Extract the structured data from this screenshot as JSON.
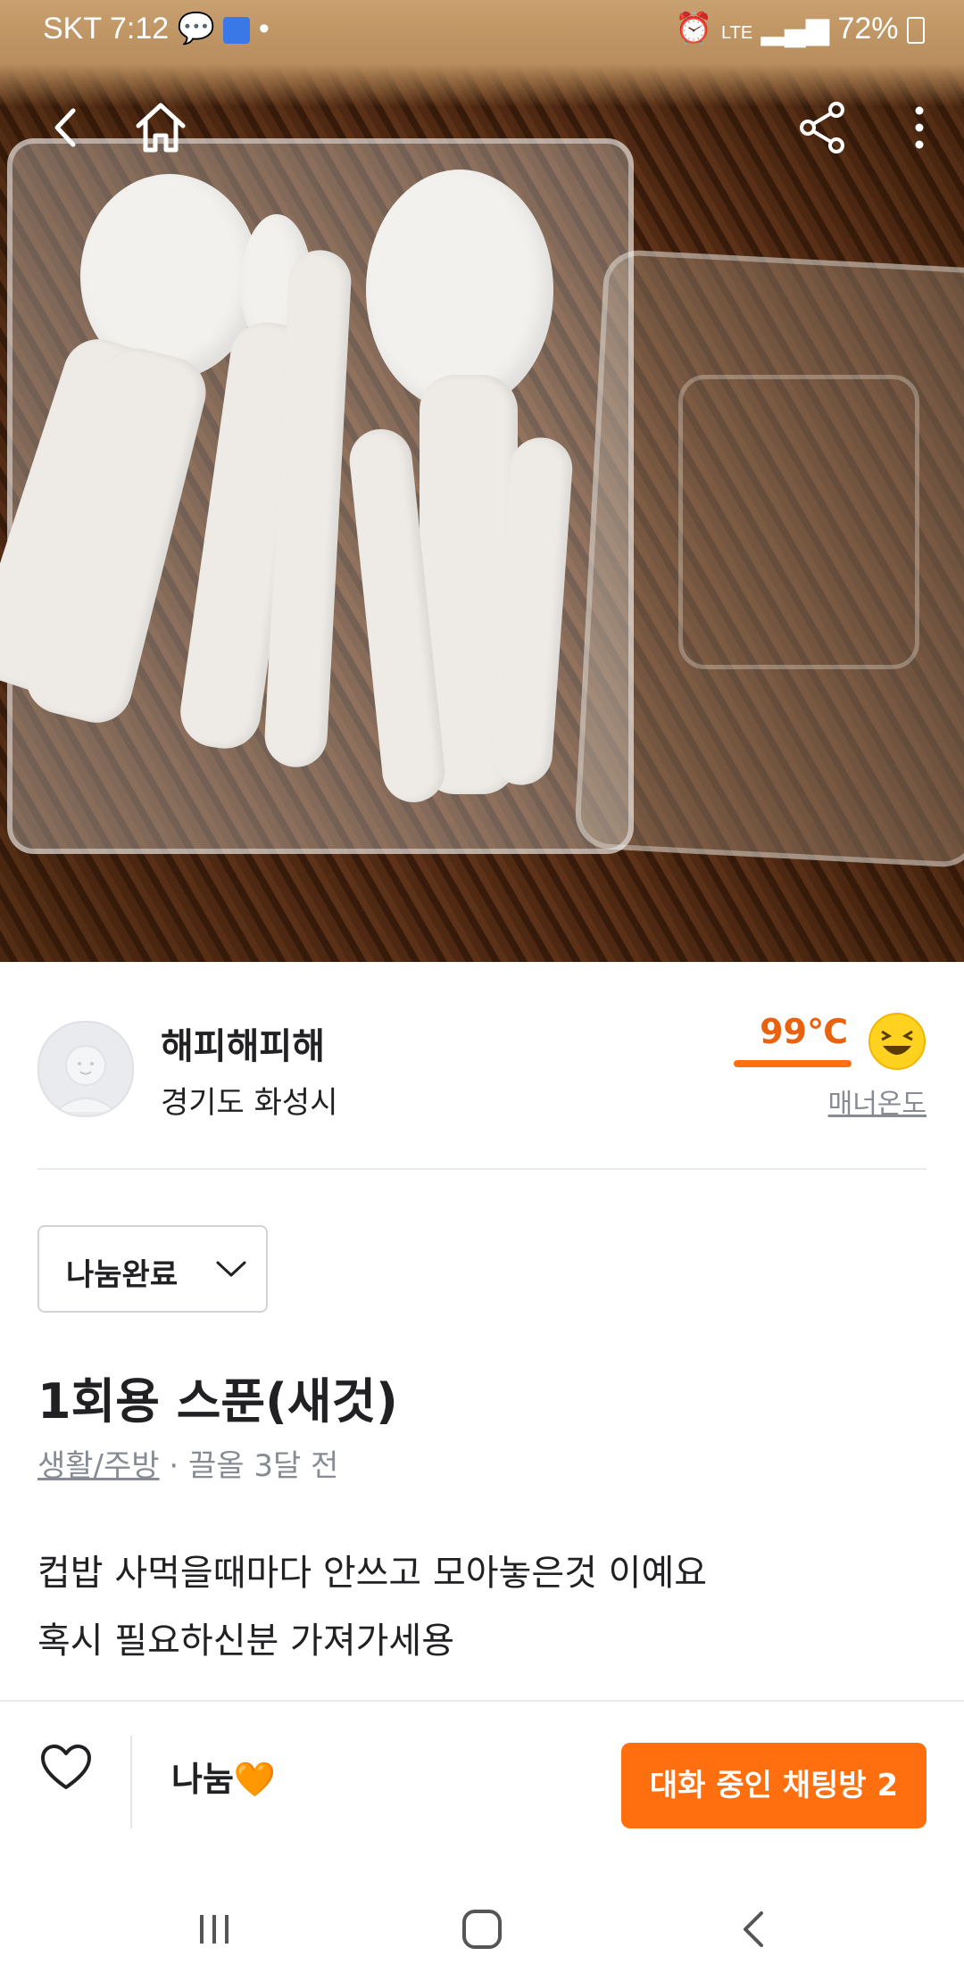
{
  "status_bar": {
    "carrier": "SKT",
    "time": "7:12",
    "network": "LTE",
    "battery": "72%"
  },
  "product": {
    "title": "1회용 스푼(새것)",
    "category": "생활/주방",
    "meta_separator": " · ",
    "bumped": "끌올 3달 전",
    "description_lines": [
      "컵밥 사먹을때마다 안쓰고 모아놓은것 이예요",
      "혹시 필요하신분 가져가세용"
    ],
    "status": "나눔완료"
  },
  "seller": {
    "name": "해피해피해",
    "location": "경기도 화성시",
    "temperature": "99℃",
    "temperature_label": "매너온도"
  },
  "bottom_bar": {
    "price_label": "나눔",
    "price_emoji": "🧡",
    "chat_button": "대화 중인 채팅방 2"
  },
  "colors": {
    "accent": "#ff6f0f",
    "temperature_text": "#e8620f",
    "muted_text": "#868b94",
    "divider": "#e9ecef"
  },
  "icons": {
    "back": "back-arrow-icon",
    "home": "home-icon",
    "share": "share-icon",
    "more": "more-vertical-icon",
    "favorite": "heart-icon",
    "status_dropdown": "chevron-down-icon",
    "nav_recents": "recents-icon",
    "nav_home": "nav-home-icon",
    "nav_back": "nav-back-icon"
  }
}
